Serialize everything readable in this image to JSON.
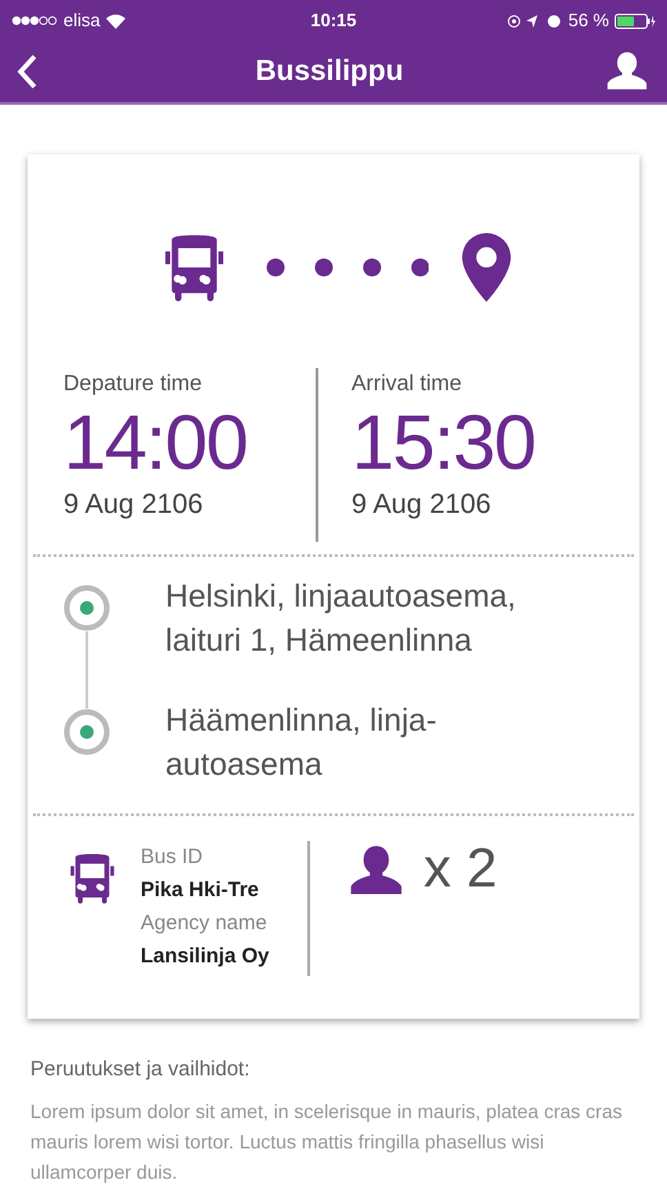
{
  "status_bar": {
    "carrier": "elisa",
    "time": "10:15",
    "battery": "56 %"
  },
  "nav": {
    "title": "Bussilippu"
  },
  "departure": {
    "label": "Depature time",
    "time": "14:00",
    "date": "9 Aug 2106"
  },
  "arrival": {
    "label": "Arrival time",
    "time": "15:30",
    "date": "9 Aug 2106"
  },
  "stops": [
    {
      "name": "Helsinki, linjaautoasema, laituri 1, Hämeenlinna"
    },
    {
      "name": "Häämenlinna, linja-autoasema"
    }
  ],
  "bus": {
    "id_label": "Bus ID",
    "id": "Pika Hki-Tre",
    "agency_label": "Agency name",
    "agency": "Lansilinja Oy"
  },
  "passengers": "x 2",
  "notes": {
    "title": "Peruutukset ja vailhidot:",
    "body": "Lorem ipsum dolor sit amet, in scelerisque in mauris, platea cras cras mauris lorem wisi tortor. Luctus mattis fringilla phasellus wisi ullamcorper duis."
  }
}
